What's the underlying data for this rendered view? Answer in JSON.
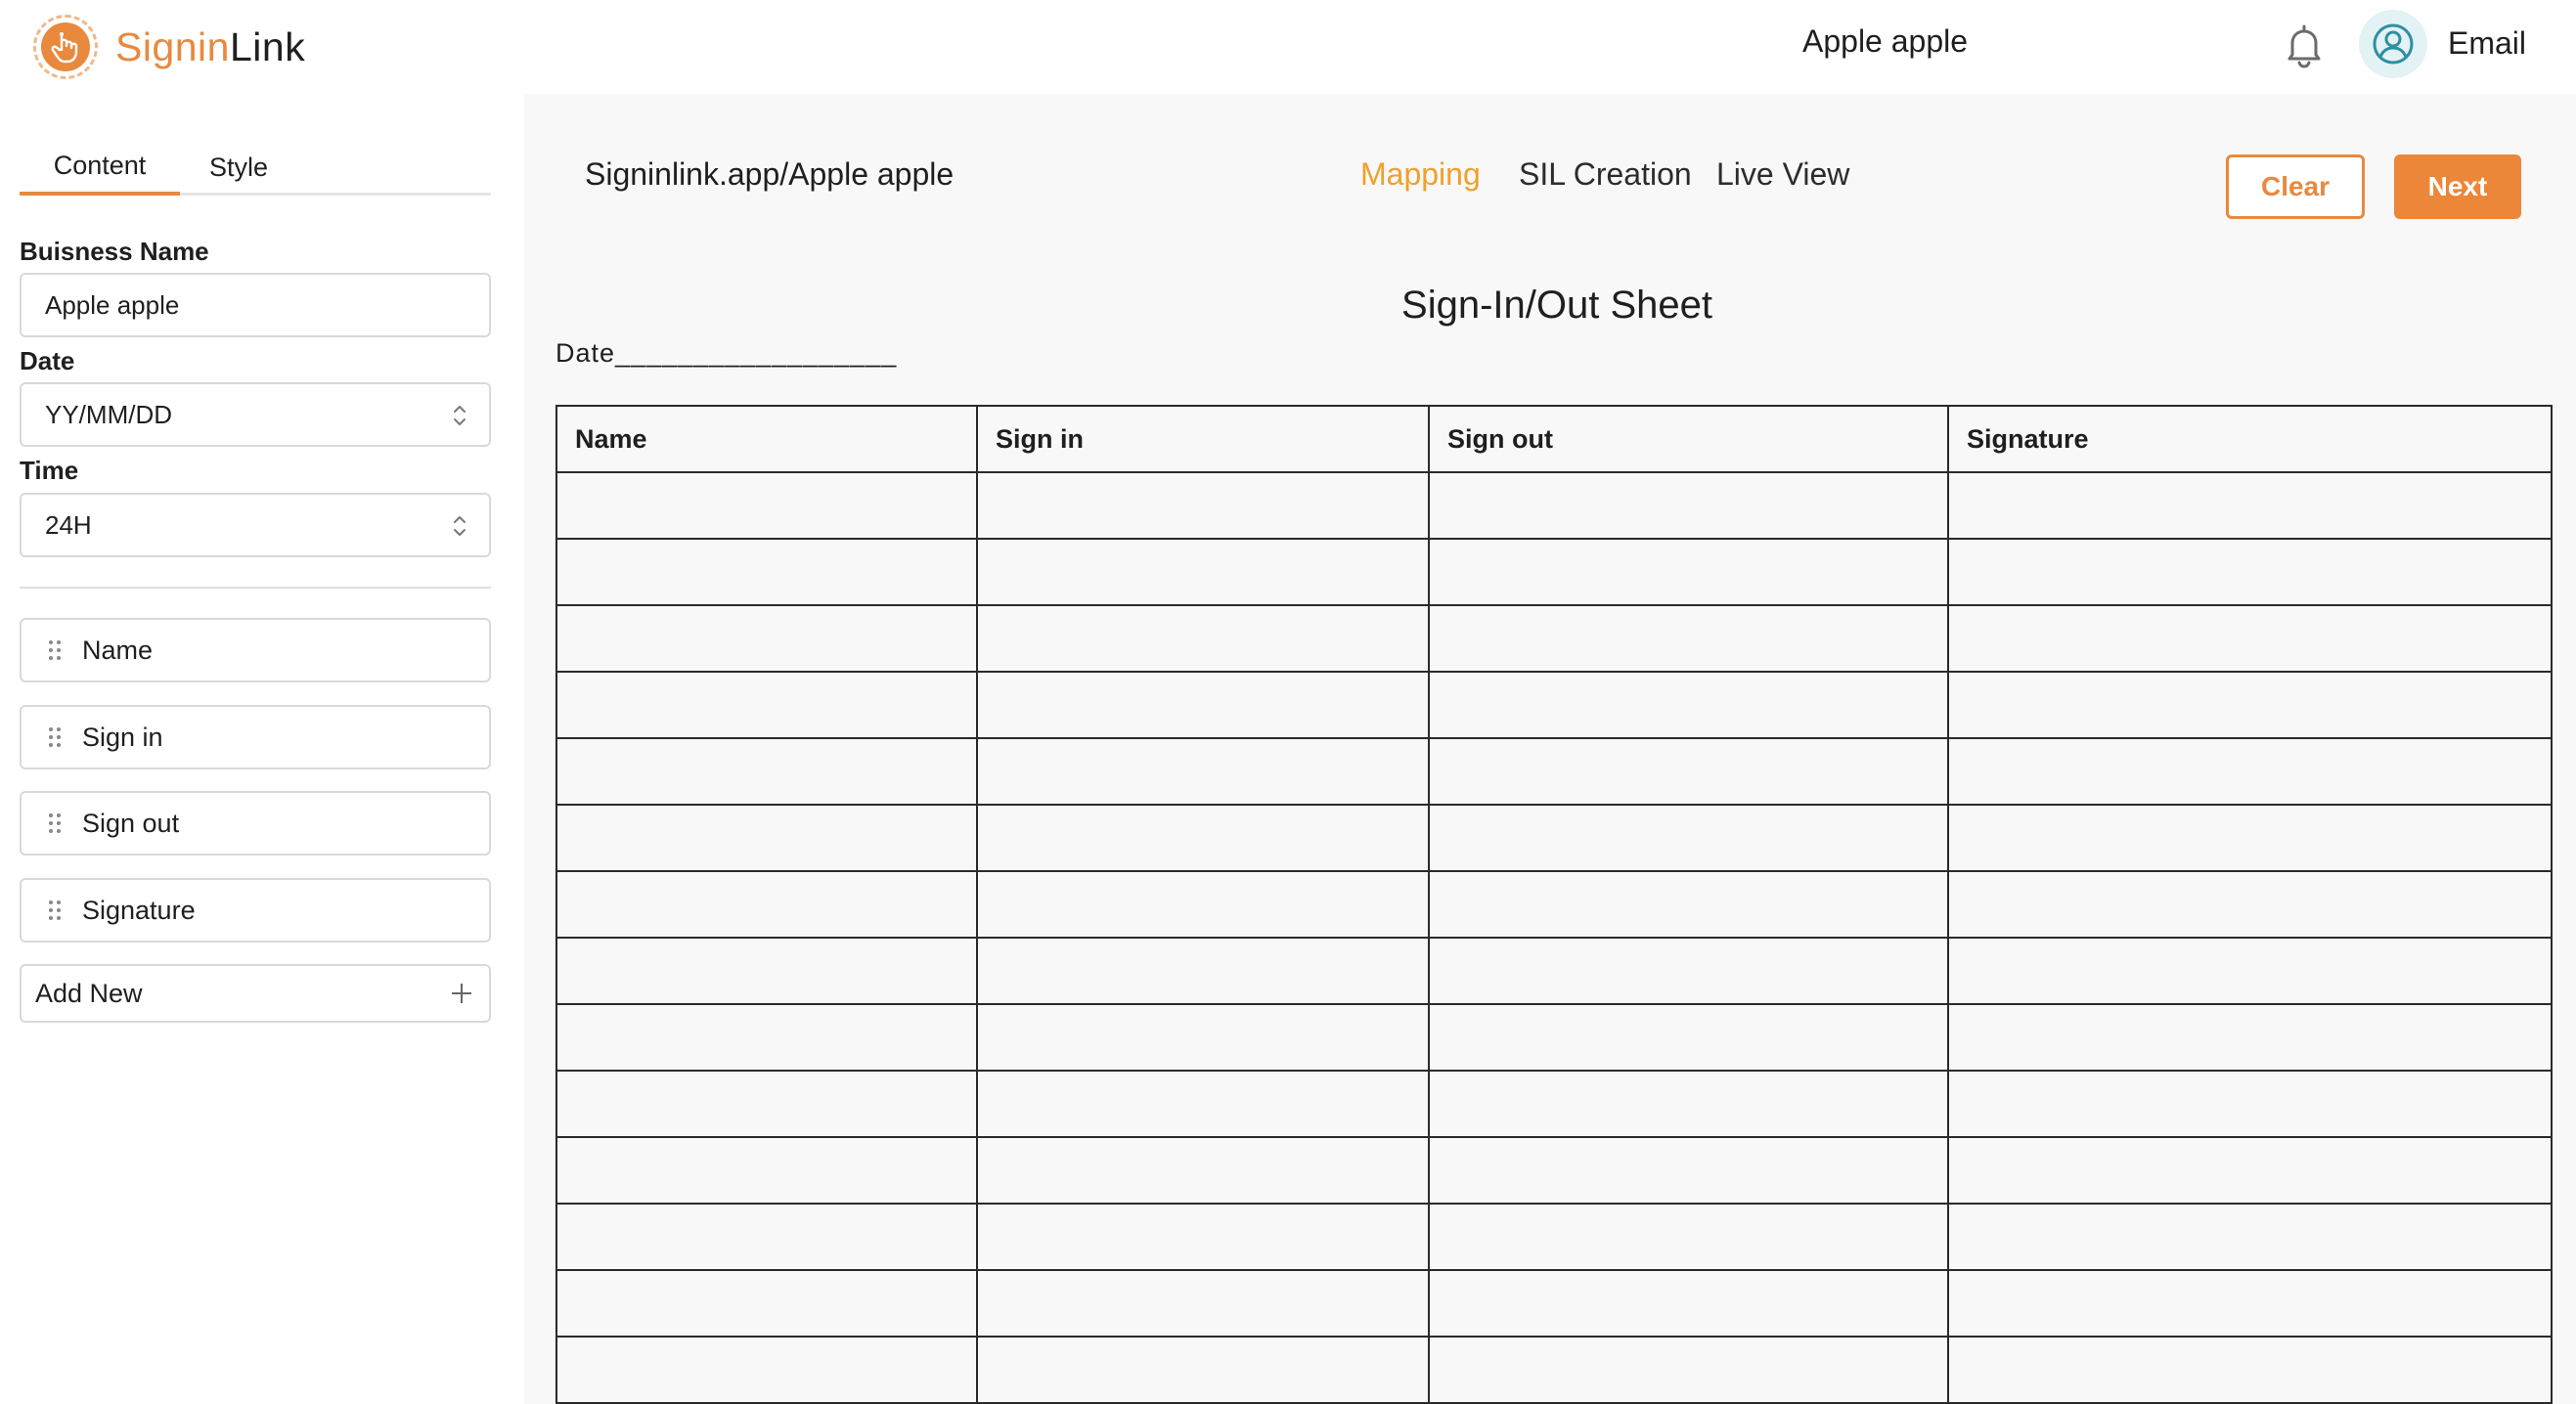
{
  "app": {
    "logo_part1": "Signin",
    "logo_part2": "Link",
    "business_title": "Apple apple",
    "email_label": "Email"
  },
  "left_panel": {
    "tabs": [
      {
        "label": "Content"
      },
      {
        "label": "Style"
      }
    ],
    "business_name_label": "Buisness Name",
    "business_name_value": "Apple apple",
    "date_label": "Date",
    "date_value": "YY/MM/DD",
    "time_label": "Time",
    "time_value": "24H",
    "columns": [
      {
        "label": "Name"
      },
      {
        "label": "Sign in"
      },
      {
        "label": "Sign out"
      },
      {
        "label": "Signature"
      }
    ],
    "add_new_label": "Add New"
  },
  "main": {
    "url": "Signinlink.app/Apple apple",
    "steps": [
      {
        "label": "Mapping",
        "active": true
      },
      {
        "label": "SIL Creation",
        "active": false
      },
      {
        "label": "Live View",
        "active": false
      }
    ],
    "clear_label": "Clear",
    "next_label": "Next",
    "sheet_title": "Sign-In/Out Sheet",
    "date_line": "Date__________________",
    "table_headers": [
      "Name",
      "Sign in",
      "Sign out",
      "Signature"
    ],
    "empty_rows": 14
  },
  "colors": {
    "accent": "#e8893e",
    "active_step": "#f0a02a",
    "main_bg": "#f8f8f8"
  },
  "icons": {
    "logo": "hand-tap-icon",
    "bell": "bell-icon",
    "avatar": "user-circle-icon",
    "grip": "drag-handle-icon",
    "spinner": "up-down-chevron-icon",
    "plus": "plus-icon"
  }
}
